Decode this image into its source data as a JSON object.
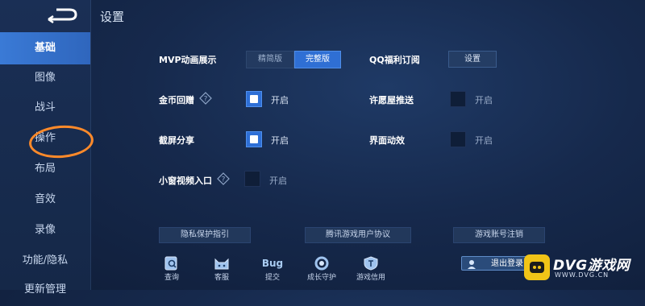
{
  "header": {
    "title": "设置"
  },
  "sidebar": {
    "items": [
      {
        "label": "基础",
        "active": true
      },
      {
        "label": "图像"
      },
      {
        "label": "战斗"
      },
      {
        "label": "操作"
      },
      {
        "label": "布局"
      },
      {
        "label": "音效"
      },
      {
        "label": "录像"
      },
      {
        "label": "功能/隐私"
      },
      {
        "label": "更新管理"
      }
    ]
  },
  "settings": {
    "mvp": {
      "label": "MVP动画展示",
      "options": [
        "精简版",
        "完整版"
      ],
      "selected": "完整版"
    },
    "qq": {
      "label": "QQ福利订阅",
      "button": "设置"
    },
    "gold": {
      "label": "金币回赠",
      "value": "开启",
      "checked": true
    },
    "wish": {
      "label": "许愿屋推送",
      "value": "开启",
      "checked": false
    },
    "screenshot": {
      "label": "截屏分享",
      "value": "开启",
      "checked": true
    },
    "ui_fx": {
      "label": "界面动效",
      "value": "开启",
      "checked": false
    },
    "mini_video": {
      "label": "小窗视频入口",
      "value": "开启",
      "checked": false
    }
  },
  "links": {
    "privacy": "隐私保护指引",
    "agreement": "腾讯游戏用户协议",
    "cancel": "游戏账号注销"
  },
  "bottom_bar": {
    "items": [
      {
        "label": "查询",
        "icon": "search-doc-icon"
      },
      {
        "label": "客服",
        "icon": "cat-icon"
      },
      {
        "label": "提交",
        "icon": "bug-icon"
      },
      {
        "label": "成长守护",
        "icon": "ring-icon"
      },
      {
        "label": "游戏信用",
        "icon": "shield-icon"
      }
    ],
    "bug_text": "Bug",
    "logout": "退出登录"
  },
  "watermark": {
    "text": "DVG游戏网",
    "sub": "WWW.DVG.CN"
  },
  "colors": {
    "accent": "#2f6fd4",
    "highlight_circle": "#ff8a2a",
    "brand_yellow": "#f1c417"
  }
}
